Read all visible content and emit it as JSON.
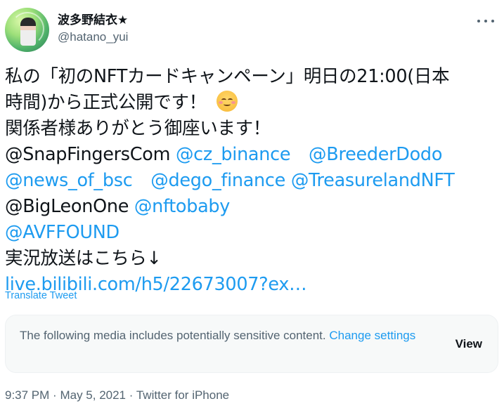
{
  "author": {
    "display_name": "波多野結衣★",
    "handle": "@hatano_yui"
  },
  "tweet": {
    "line1_a": "私の「初のNFTカードキャンペーン」明日の21:00(日本",
    "line2_a": "時間)から正式公開です！",
    "line3_a": "関係者様ありがとう御座います！",
    "mentions": {
      "snapfingers": "@SnapFingersCom",
      "cz_binance": "@cz_binance",
      "breederdodo": "@BreederDodo",
      "news_of_bsc": "@news_of_bsc",
      "dego_finance": "@dego_finance",
      "treasureland": "@TreasurelandNFT",
      "bigleon": "@BigLeonOne",
      "nftobaby": "@nftobaby",
      "avffound": "@AVFFOUND"
    },
    "live_text": "実況放送はこちら↓",
    "link": "live.bilibili.com/h5/22673007?ex…",
    "emoji_icon": "smiling-face-with-smiling-eyes-icon"
  },
  "translate_label": "Translate Tweet",
  "sensitive": {
    "message": "The following media includes potentially sensitive content.",
    "change_settings": "Change settings",
    "view_label": "View"
  },
  "meta": {
    "time": "9:37 PM",
    "date": "May 5, 2021",
    "separator": "·",
    "source": "Twitter for iPhone"
  },
  "colors": {
    "link": "#1d9bf0",
    "secondary_text": "#536471",
    "primary_text": "#0f1419",
    "sensitive_bg": "#f7f9f9"
  }
}
